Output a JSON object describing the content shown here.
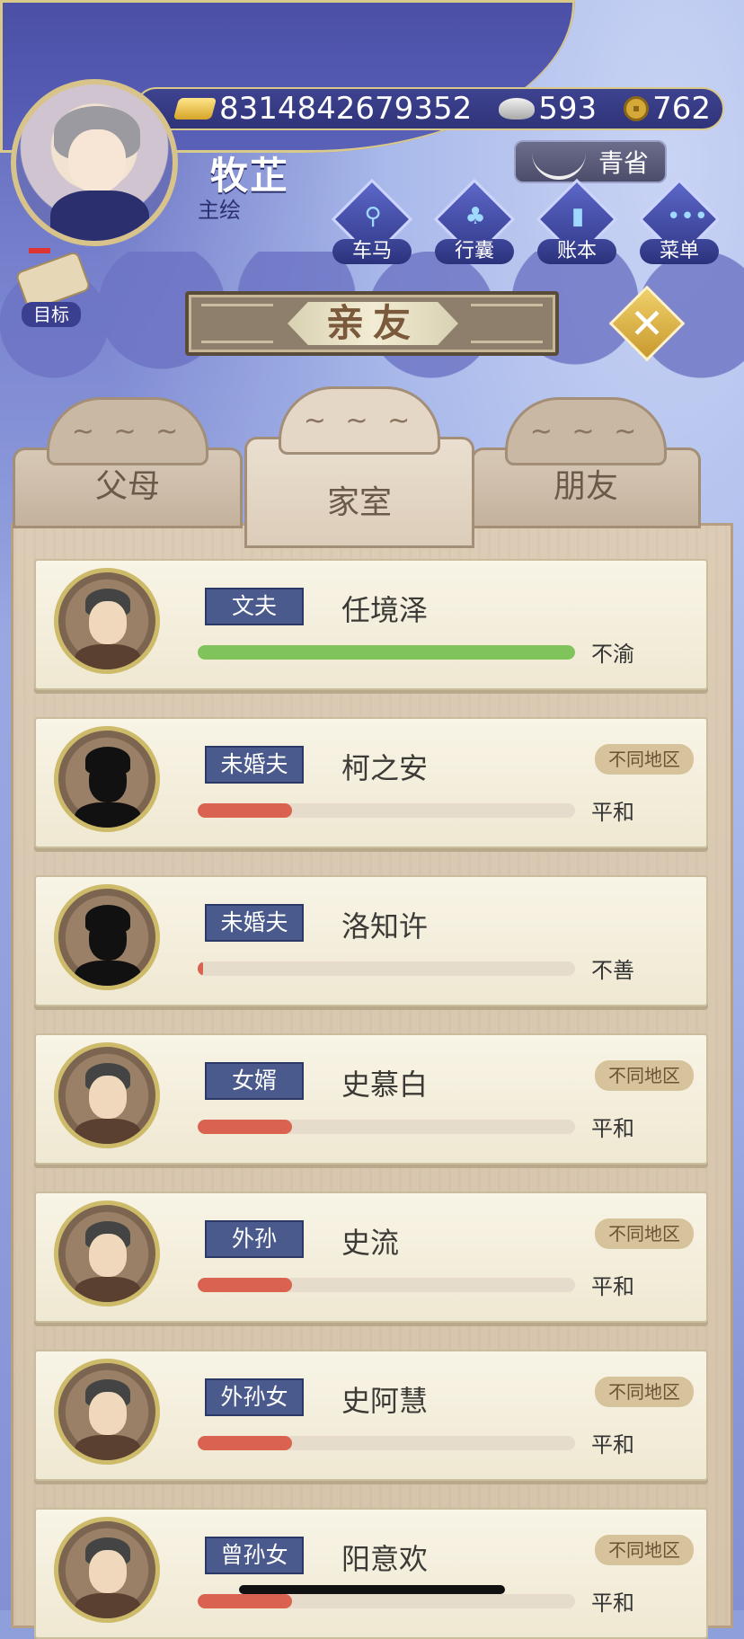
{
  "header": {
    "player_name": "牧芷",
    "player_title": "主绘",
    "gold": "8314842679352",
    "silver": "593",
    "coins": "762",
    "action_label": "青省"
  },
  "menu": [
    {
      "label": "车马",
      "icon": "carriage-icon"
    },
    {
      "label": "行囊",
      "icon": "bag-icon"
    },
    {
      "label": "账本",
      "icon": "ledger-icon"
    },
    {
      "label": "菜单",
      "icon": "more-icon"
    }
  ],
  "goal_label": "目标",
  "page_title": "亲友",
  "tabs": [
    {
      "label": "父母",
      "active": false
    },
    {
      "label": "家室",
      "active": true
    },
    {
      "label": "朋友",
      "active": false
    }
  ],
  "colors": {
    "bar_green": "#7fc35a",
    "bar_red": "#d96350"
  },
  "relatives": [
    {
      "relation": "文夫",
      "name": "任境泽",
      "status": "不渝",
      "region": "",
      "affinity": 1.0,
      "bar_color": "green",
      "silhouette": false
    },
    {
      "relation": "未婚夫",
      "name": "柯之安",
      "status": "平和",
      "region": "不同地区",
      "affinity": 0.25,
      "bar_color": "red",
      "silhouette": true
    },
    {
      "relation": "未婚夫",
      "name": "洛知许",
      "status": "不善",
      "region": "",
      "affinity": 0.01,
      "bar_color": "red",
      "silhouette": true
    },
    {
      "relation": "女婿",
      "name": "史慕白",
      "status": "平和",
      "region": "不同地区",
      "affinity": 0.25,
      "bar_color": "red",
      "silhouette": false
    },
    {
      "relation": "外孙",
      "name": "史流",
      "status": "平和",
      "region": "不同地区",
      "affinity": 0.25,
      "bar_color": "red",
      "silhouette": false
    },
    {
      "relation": "外孙女",
      "name": "史阿慧",
      "status": "平和",
      "region": "不同地区",
      "affinity": 0.25,
      "bar_color": "red",
      "silhouette": false
    },
    {
      "relation": "曾孙女",
      "name": "阳意欢",
      "status": "平和",
      "region": "不同地区",
      "affinity": 0.25,
      "bar_color": "red",
      "silhouette": false
    }
  ]
}
